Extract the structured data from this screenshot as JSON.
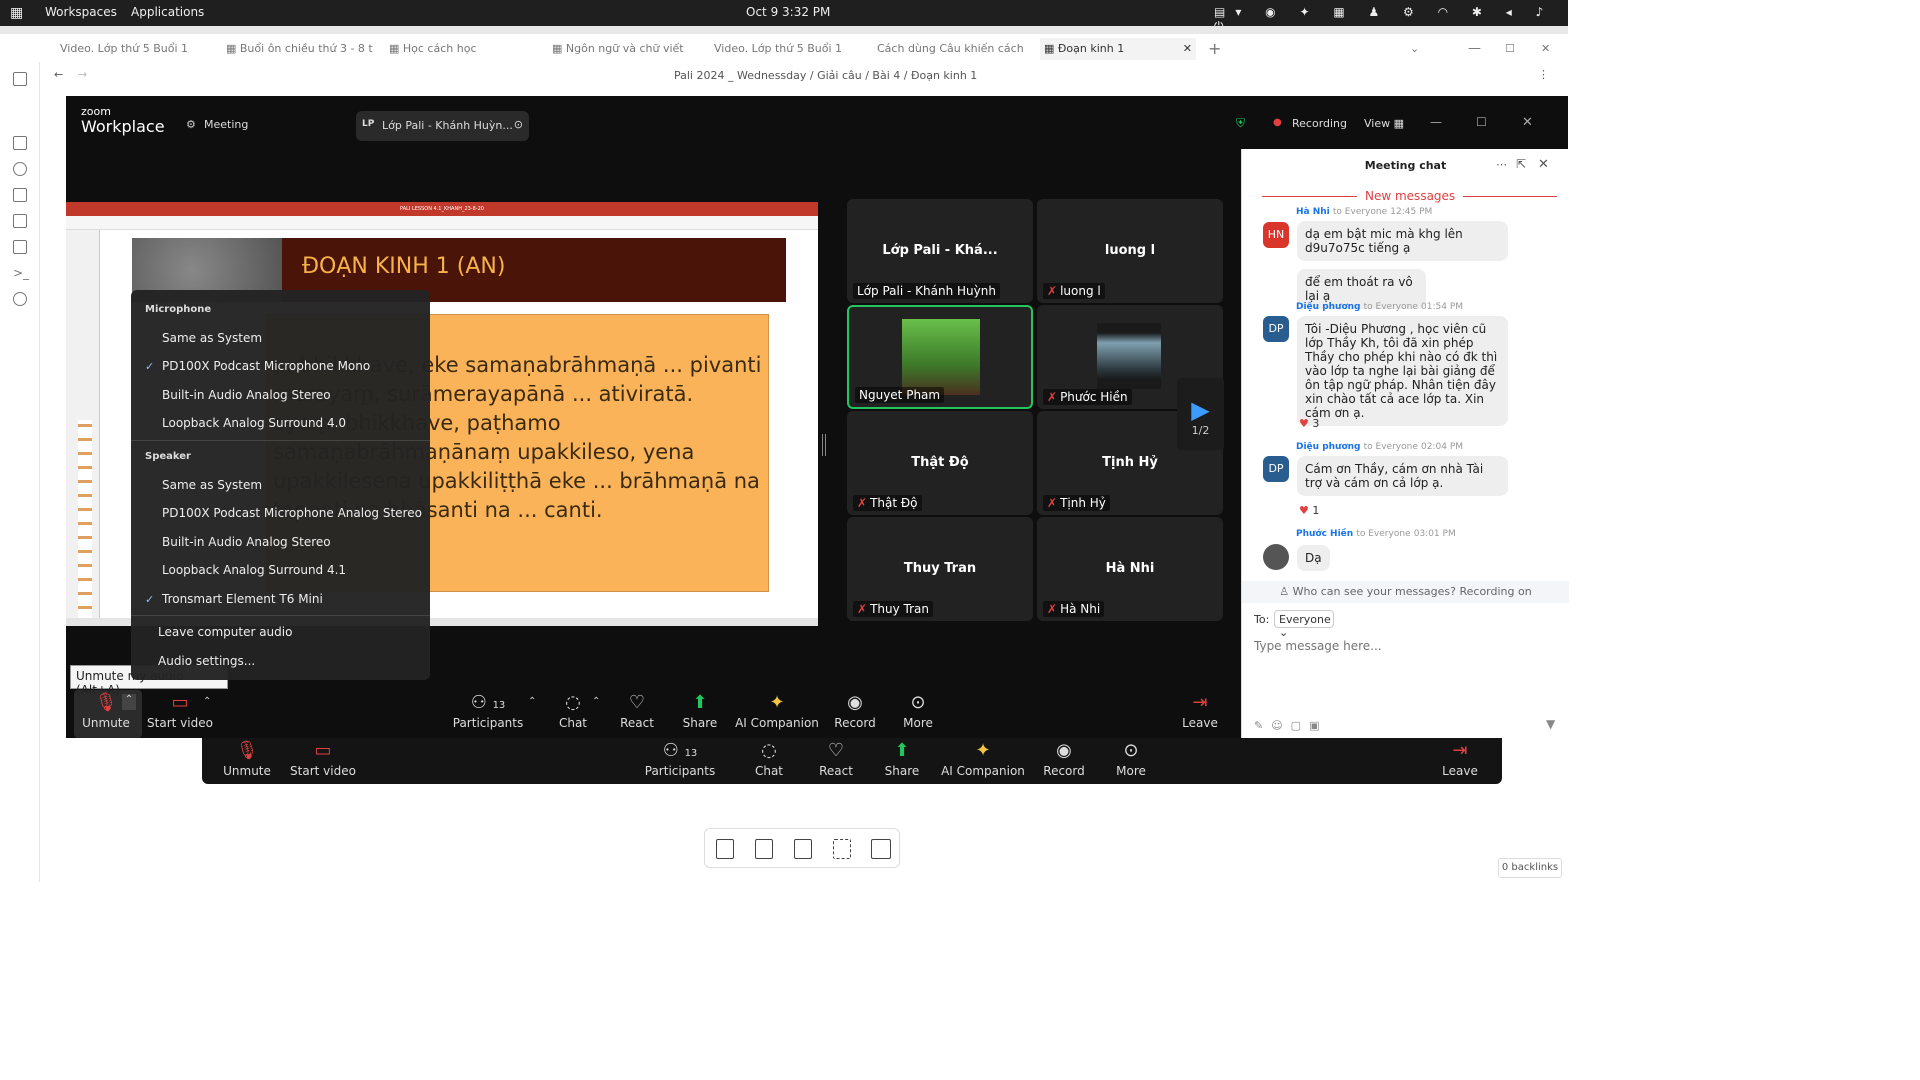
{
  "topbar": {
    "workspaces": "Workspaces",
    "applications": "Applications",
    "datetime": "Oct 9   3:32 PM"
  },
  "tabs": [
    "Video. Lớp thứ 5 Buổi 1",
    "Buổi ôn chiều thứ 3 - 8 t...",
    "Học cách học",
    "Ngôn ngữ và chữ viết",
    "Video. Lớp thứ 5 Buổi 1",
    "Cách dùng Câu khiến cách",
    "Đoạn kinh 1"
  ],
  "breadcrumb": "Pali 2024 _ Wednessday  /  Giải câu  /  Bài 4  /  Đoạn kinh 1",
  "zoom": {
    "logo_top": "zoom",
    "logo_bottom": "Workplace",
    "meeting": "Meeting",
    "meeting_name": "Lớp Pali - Khánh Huỳn...",
    "meeting_badge": "LP",
    "recording": "Recording",
    "view": "View"
  },
  "slide": {
    "ribbon_title": "PALI LESSON 4.1_KHANH_23-8-20",
    "title": "ĐOẠN KINH 1 (AN)",
    "body": "... bhikkhave, eke samaṇabrāhmaṇā ... pivanti merayaṃ, surāmerayapānā ... ativiratā. ayaṃ, bhikkhave, paṭhamo samaṇabrāhmaṇānaṃ upakkileso, yena upakkilesena upakkiliṭṭhā eke ... brāhmaṇā na tapanti na bhāsanti na ... canti."
  },
  "tiles": [
    {
      "name": "Lớp Pali - Khá...",
      "label": "Lớp Pali - Khánh Huỳnh",
      "muted": false
    },
    {
      "name": "luong l",
      "label": "luong l",
      "muted": true
    },
    {
      "name": "",
      "label": "Nguyet Pham",
      "muted": false
    },
    {
      "name": "",
      "label": "Phước Hiền",
      "muted": true
    },
    {
      "name": "Thật Độ",
      "label": "Thật Độ",
      "muted": true
    },
    {
      "name": "Tịnh Hỷ",
      "label": "Tịnh Hỷ",
      "muted": true
    },
    {
      "name": "Thuy Tran",
      "label": "Thuy Tran",
      "muted": true
    },
    {
      "name": "Hà Nhi",
      "label": "Hà Nhi",
      "muted": true
    }
  ],
  "page_indicator": "1/2",
  "menu": {
    "mic_header": "Microphone",
    "mic": [
      "Same as System",
      "PD100X Podcast Microphone Mono",
      "Built-in Audio Analog Stereo",
      "Loopback Analog Surround 4.0"
    ],
    "speaker_header": "Speaker",
    "speaker": [
      "Same as System",
      "PD100X Podcast Microphone Analog Stereo",
      "Built-in Audio Analog Stereo",
      "Loopback Analog Surround 4.1",
      "Tronsmart Element T6 Mini"
    ],
    "leave": "Leave computer audio",
    "settings": "Audio settings..."
  },
  "tooltip": "Unmute my audio (Alt+A)",
  "toolbar": {
    "unmute": "Unmute",
    "start_video": "Start video",
    "participants": "Participants",
    "participants_count": "13",
    "chat": "Chat",
    "react": "React",
    "share": "Share",
    "ai": "AI Companion",
    "record": "Record",
    "more": "More",
    "leave": "Leave"
  },
  "chat": {
    "title": "Meeting chat",
    "new_messages": "New messages",
    "m1": {
      "from": "Hà Nhi",
      "to": "to Everyone",
      "time": "12:45 PM",
      "avatar": "HN",
      "t1": "dạ em bật mic mà khg lên d9u7o75c tiếng ạ",
      "t2": "để em thoát ra vô lại ạ"
    },
    "m2": {
      "from": "Diệu phương",
      "to": "to Everyone",
      "time": "01:54 PM",
      "avatar": "DP",
      "t1": "Tôi -Diệu Phương , học viên cũ lớp Thầy Kh, tôi đã xin phép Thầy cho phép khi nào có đk thì vào lớp ta nghe lại bài giảng để ôn tập ngữ pháp. Nhân tiện đây xin chào tất cả ace  lớp ta. Xin cám ơn ạ.",
      "reacts": "3"
    },
    "m3": {
      "from": "Diệu phương",
      "to": "to Everyone",
      "time": "02:04 PM",
      "avatar": "DP",
      "t1": "Cám ơn Thầy, cám ơn nhà Tài trợ và cám ơn cả lớp ạ.",
      "reacts": "1"
    },
    "m4": {
      "from": "Phước Hiền",
      "to": "to Everyone",
      "time": "03:01 PM",
      "t1": "Dạ"
    },
    "privacy": "Who can see your messages? Recording on",
    "to_label": "To:",
    "to_value": "Everyone",
    "placeholder": "Type message here..."
  },
  "backlinks": "0 backlinks",
  "colors": {
    "accent": "#1a73e8",
    "share_green": "#22c55e",
    "mute_red": "#e04040",
    "slide_orange": "#fbb35a",
    "slide_header": "#4a1408"
  }
}
